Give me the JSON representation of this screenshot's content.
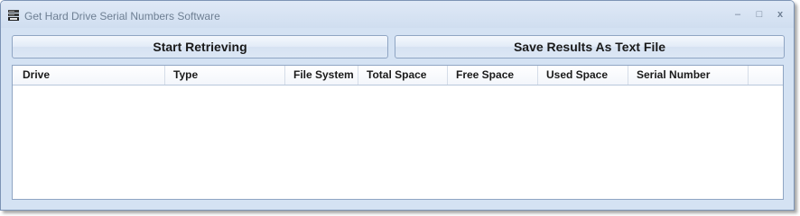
{
  "window": {
    "title": "Get Hard Drive Serial Numbers Software",
    "app_icon": "hard-drive-app-icon",
    "controls": {
      "minimize_glyph": "–",
      "maximize_glyph": "□",
      "close_glyph": "x"
    }
  },
  "toolbar": {
    "start_label": "Start Retrieving",
    "save_label": "Save Results As Text File"
  },
  "results_table": {
    "columns": [
      "Drive",
      "Type",
      "File System",
      "Total Space",
      "Free Space",
      "Used Space",
      "Serial Number"
    ],
    "rows": []
  }
}
